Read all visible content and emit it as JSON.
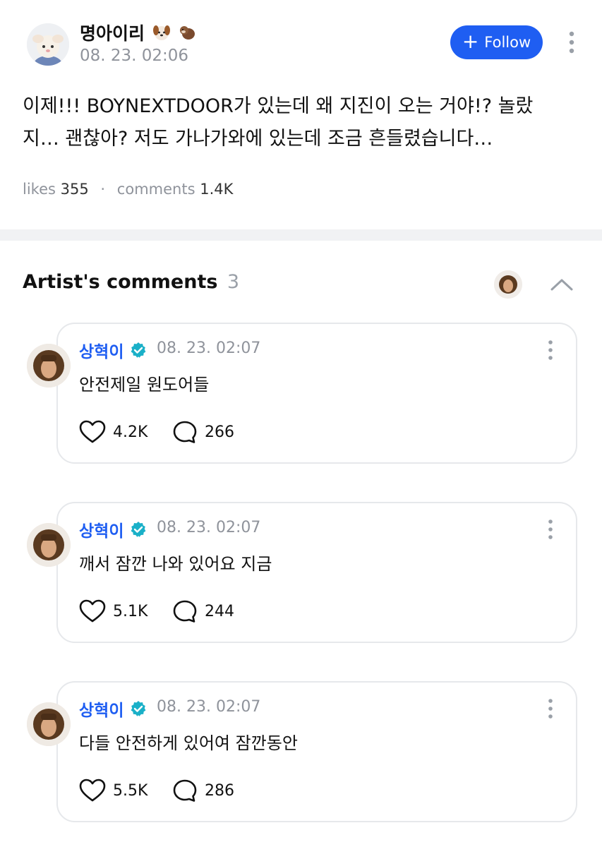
{
  "post": {
    "author_name": "명아이리",
    "author_emoji": [
      "dog-face-emoji",
      "otter-emoji"
    ],
    "time": "08. 23. 02:06",
    "follow_label": "Follow",
    "follow_icon": "plus-icon",
    "body_line1": "이제!!! BOYNEXTDOOR가 있는데 왜 지진이 오는 거야!? 놀랐",
    "body_line2": "지… 괜찮아? 저도 가나가와에 있는데 조금 흔들렸습니다…",
    "stats": {
      "likes_label": "likes",
      "likes_value": "355",
      "separator": "·",
      "comments_label": "comments",
      "comments_value": "1.4K"
    }
  },
  "artist_comments": {
    "title": "Artist's comments",
    "count": "3",
    "collapse_icon": "chevron-up-icon",
    "items": [
      {
        "name": "상혁이",
        "time": "08. 23. 02:07",
        "text": "안전제일 원도어들",
        "likes": "4.2K",
        "replies": "266"
      },
      {
        "name": "상혁이",
        "time": "08. 23. 02:07",
        "text": "깨서 잠깐 나와 있어요 지금",
        "likes": "5.1K",
        "replies": "244"
      },
      {
        "name": "상혁이",
        "time": "08. 23. 02:07",
        "text": "다들 안전하게 있어여 잠깐동안",
        "likes": "5.5K",
        "replies": "286"
      }
    ]
  },
  "colors": {
    "accent": "#1f5ef2",
    "verified": "#1ab0c8",
    "muted": "#8f939b",
    "divider": "#f1f2f4",
    "card_border": "#e6e8eb"
  }
}
